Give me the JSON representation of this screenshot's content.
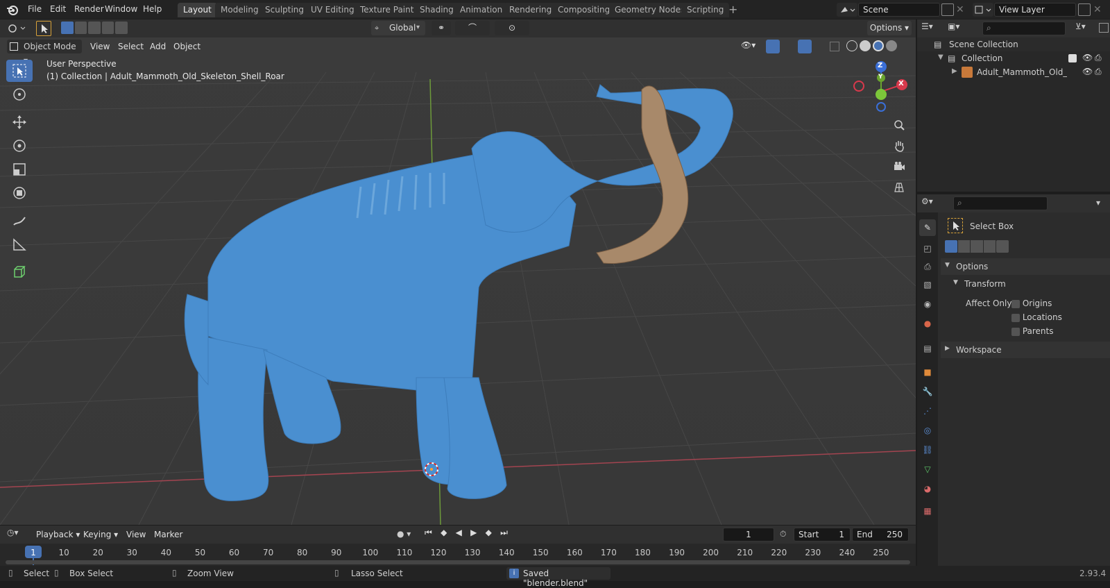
{
  "menubar": {
    "items": [
      "File",
      "Edit",
      "Render",
      "Window",
      "Help"
    ]
  },
  "workspaces": [
    {
      "label": "Layout",
      "active": true
    },
    {
      "label": "Modeling"
    },
    {
      "label": "Sculpting"
    },
    {
      "label": "UV Editing"
    },
    {
      "label": "Texture Paint"
    },
    {
      "label": "Shading"
    },
    {
      "label": "Animation"
    },
    {
      "label": "Rendering"
    },
    {
      "label": "Compositing"
    },
    {
      "label": "Geometry Nodes"
    },
    {
      "label": "Scripting"
    }
  ],
  "scene": {
    "name": "Scene",
    "view_layer": "View Layer"
  },
  "tool_header": {
    "orientation": "Global",
    "options": "Options"
  },
  "viewport": {
    "mode": "Object Mode",
    "menus": [
      "View",
      "Select",
      "Add",
      "Object"
    ],
    "overlay_title": "User Perspective",
    "overlay_subtitle": "(1) Collection | Adult_Mammoth_Old_Skeleton_Shell_Roar",
    "gizmo": {
      "z": "Z",
      "y": "Y",
      "x": "X"
    }
  },
  "outliner": {
    "root": "Scene Collection",
    "collection": "Collection",
    "object": "Adult_Mammoth_Old_Ske"
  },
  "properties": {
    "tool_name": "Select Box",
    "options_label": "Options",
    "transform_label": "Transform",
    "affect_only_label": "Affect Only",
    "checkboxes": [
      "Origins",
      "Locations",
      "Parents"
    ],
    "workspace_label": "Workspace"
  },
  "timeline": {
    "menus": [
      "Playback",
      "Keying",
      "View",
      "Marker"
    ],
    "current_frame": "1",
    "start_label": "Start",
    "start": "1",
    "end_label": "End",
    "end": "250",
    "ticks": [
      "1",
      "10",
      "20",
      "30",
      "40",
      "50",
      "60",
      "70",
      "80",
      "90",
      "100",
      "110",
      "120",
      "130",
      "140",
      "150",
      "160",
      "170",
      "180",
      "190",
      "200",
      "210",
      "220",
      "230",
      "240",
      "250"
    ]
  },
  "statusbar": {
    "select": "Select",
    "box_select": "Box Select",
    "zoom_view": "Zoom View",
    "lasso_select": "Lasso Select",
    "message": "Saved \"blender.blend\"",
    "version": "2.93.4"
  },
  "colors": {
    "accent": "#4772b3",
    "model_blue": "#4a8fd0",
    "tusk": "#a8896a"
  }
}
